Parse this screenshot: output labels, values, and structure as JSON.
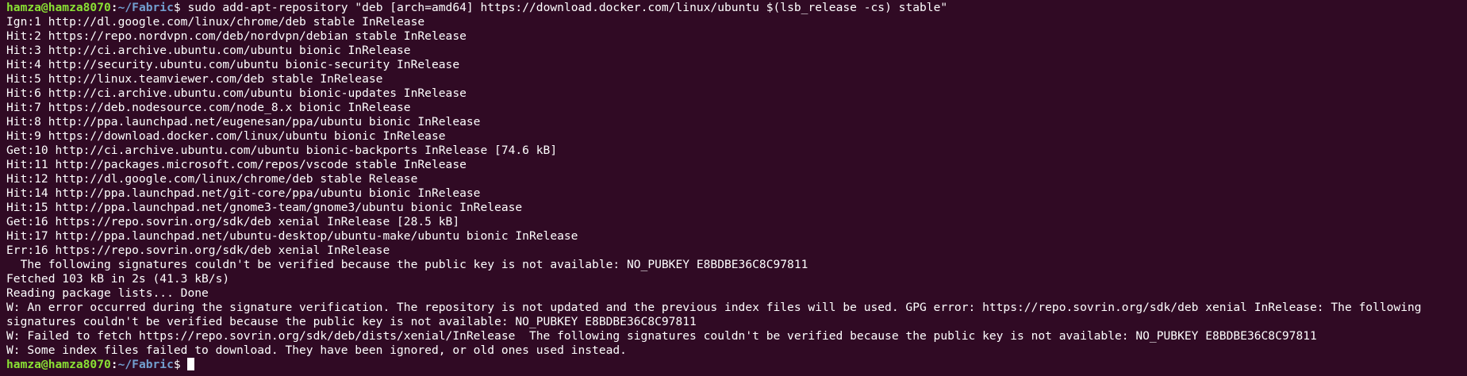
{
  "colors": {
    "background": "#300a24",
    "text": "#ffffff",
    "prompt_user": "#8ae234",
    "prompt_path": "#729fcf"
  },
  "prompt": {
    "user_host": "hamza@hamza8070",
    "separator": ":",
    "path": "~/Fabric",
    "symbol": "$ "
  },
  "command": "sudo add-apt-repository \"deb [arch=amd64] https://download.docker.com/linux/ubuntu $(lsb_release -cs) stable\"",
  "output_lines": [
    "Ign:1 http://dl.google.com/linux/chrome/deb stable InRelease",
    "Hit:2 https://repo.nordvpn.com/deb/nordvpn/debian stable InRelease",
    "Hit:3 http://ci.archive.ubuntu.com/ubuntu bionic InRelease",
    "Hit:4 http://security.ubuntu.com/ubuntu bionic-security InRelease",
    "Hit:5 http://linux.teamviewer.com/deb stable InRelease",
    "Hit:6 http://ci.archive.ubuntu.com/ubuntu bionic-updates InRelease",
    "Hit:7 https://deb.nodesource.com/node_8.x bionic InRelease",
    "Hit:8 http://ppa.launchpad.net/eugenesan/ppa/ubuntu bionic InRelease",
    "Hit:9 https://download.docker.com/linux/ubuntu bionic InRelease",
    "Get:10 http://ci.archive.ubuntu.com/ubuntu bionic-backports InRelease [74.6 kB]",
    "Hit:11 http://packages.microsoft.com/repos/vscode stable InRelease",
    "Hit:12 http://dl.google.com/linux/chrome/deb stable Release",
    "Hit:14 http://ppa.launchpad.net/git-core/ppa/ubuntu bionic InRelease",
    "Hit:15 http://ppa.launchpad.net/gnome3-team/gnome3/ubuntu bionic InRelease",
    "Get:16 https://repo.sovrin.org/sdk/deb xenial InRelease [28.5 kB]",
    "Hit:17 http://ppa.launchpad.net/ubuntu-desktop/ubuntu-make/ubuntu bionic InRelease",
    "Err:16 https://repo.sovrin.org/sdk/deb xenial InRelease",
    "  The following signatures couldn't be verified because the public key is not available: NO_PUBKEY E8BDBE36C8C97811",
    "Fetched 103 kB in 2s (41.3 kB/s)",
    "Reading package lists... Done",
    "W: An error occurred during the signature verification. The repository is not updated and the previous index files will be used. GPG error: https://repo.sovrin.org/sdk/deb xenial InRelease: The following",
    "signatures couldn't be verified because the public key is not available: NO_PUBKEY E8BDBE36C8C97811",
    "W: Failed to fetch https://repo.sovrin.org/sdk/deb/dists/xenial/InRelease  The following signatures couldn't be verified because the public key is not available: NO_PUBKEY E8BDBE36C8C97811",
    "W: Some index files failed to download. They have been ignored, or old ones used instead."
  ]
}
